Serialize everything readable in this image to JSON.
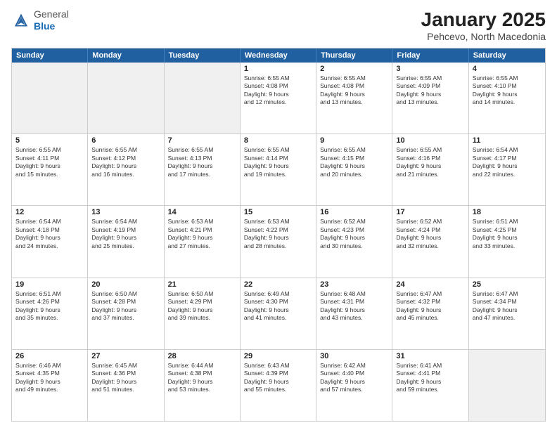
{
  "logo": {
    "general": "General",
    "blue": "Blue"
  },
  "title": "January 2025",
  "subtitle": "Pehcevo, North Macedonia",
  "days": [
    "Sunday",
    "Monday",
    "Tuesday",
    "Wednesday",
    "Thursday",
    "Friday",
    "Saturday"
  ],
  "weeks": [
    [
      {
        "day": "",
        "text": ""
      },
      {
        "day": "",
        "text": ""
      },
      {
        "day": "",
        "text": ""
      },
      {
        "day": "1",
        "text": "Sunrise: 6:55 AM\nSunset: 4:08 PM\nDaylight: 9 hours\nand 12 minutes."
      },
      {
        "day": "2",
        "text": "Sunrise: 6:55 AM\nSunset: 4:08 PM\nDaylight: 9 hours\nand 13 minutes."
      },
      {
        "day": "3",
        "text": "Sunrise: 6:55 AM\nSunset: 4:09 PM\nDaylight: 9 hours\nand 13 minutes."
      },
      {
        "day": "4",
        "text": "Sunrise: 6:55 AM\nSunset: 4:10 PM\nDaylight: 9 hours\nand 14 minutes."
      }
    ],
    [
      {
        "day": "5",
        "text": "Sunrise: 6:55 AM\nSunset: 4:11 PM\nDaylight: 9 hours\nand 15 minutes."
      },
      {
        "day": "6",
        "text": "Sunrise: 6:55 AM\nSunset: 4:12 PM\nDaylight: 9 hours\nand 16 minutes."
      },
      {
        "day": "7",
        "text": "Sunrise: 6:55 AM\nSunset: 4:13 PM\nDaylight: 9 hours\nand 17 minutes."
      },
      {
        "day": "8",
        "text": "Sunrise: 6:55 AM\nSunset: 4:14 PM\nDaylight: 9 hours\nand 19 minutes."
      },
      {
        "day": "9",
        "text": "Sunrise: 6:55 AM\nSunset: 4:15 PM\nDaylight: 9 hours\nand 20 minutes."
      },
      {
        "day": "10",
        "text": "Sunrise: 6:55 AM\nSunset: 4:16 PM\nDaylight: 9 hours\nand 21 minutes."
      },
      {
        "day": "11",
        "text": "Sunrise: 6:54 AM\nSunset: 4:17 PM\nDaylight: 9 hours\nand 22 minutes."
      }
    ],
    [
      {
        "day": "12",
        "text": "Sunrise: 6:54 AM\nSunset: 4:18 PM\nDaylight: 9 hours\nand 24 minutes."
      },
      {
        "day": "13",
        "text": "Sunrise: 6:54 AM\nSunset: 4:19 PM\nDaylight: 9 hours\nand 25 minutes."
      },
      {
        "day": "14",
        "text": "Sunrise: 6:53 AM\nSunset: 4:21 PM\nDaylight: 9 hours\nand 27 minutes."
      },
      {
        "day": "15",
        "text": "Sunrise: 6:53 AM\nSunset: 4:22 PM\nDaylight: 9 hours\nand 28 minutes."
      },
      {
        "day": "16",
        "text": "Sunrise: 6:52 AM\nSunset: 4:23 PM\nDaylight: 9 hours\nand 30 minutes."
      },
      {
        "day": "17",
        "text": "Sunrise: 6:52 AM\nSunset: 4:24 PM\nDaylight: 9 hours\nand 32 minutes."
      },
      {
        "day": "18",
        "text": "Sunrise: 6:51 AM\nSunset: 4:25 PM\nDaylight: 9 hours\nand 33 minutes."
      }
    ],
    [
      {
        "day": "19",
        "text": "Sunrise: 6:51 AM\nSunset: 4:26 PM\nDaylight: 9 hours\nand 35 minutes."
      },
      {
        "day": "20",
        "text": "Sunrise: 6:50 AM\nSunset: 4:28 PM\nDaylight: 9 hours\nand 37 minutes."
      },
      {
        "day": "21",
        "text": "Sunrise: 6:50 AM\nSunset: 4:29 PM\nDaylight: 9 hours\nand 39 minutes."
      },
      {
        "day": "22",
        "text": "Sunrise: 6:49 AM\nSunset: 4:30 PM\nDaylight: 9 hours\nand 41 minutes."
      },
      {
        "day": "23",
        "text": "Sunrise: 6:48 AM\nSunset: 4:31 PM\nDaylight: 9 hours\nand 43 minutes."
      },
      {
        "day": "24",
        "text": "Sunrise: 6:47 AM\nSunset: 4:32 PM\nDaylight: 9 hours\nand 45 minutes."
      },
      {
        "day": "25",
        "text": "Sunrise: 6:47 AM\nSunset: 4:34 PM\nDaylight: 9 hours\nand 47 minutes."
      }
    ],
    [
      {
        "day": "26",
        "text": "Sunrise: 6:46 AM\nSunset: 4:35 PM\nDaylight: 9 hours\nand 49 minutes."
      },
      {
        "day": "27",
        "text": "Sunrise: 6:45 AM\nSunset: 4:36 PM\nDaylight: 9 hours\nand 51 minutes."
      },
      {
        "day": "28",
        "text": "Sunrise: 6:44 AM\nSunset: 4:38 PM\nDaylight: 9 hours\nand 53 minutes."
      },
      {
        "day": "29",
        "text": "Sunrise: 6:43 AM\nSunset: 4:39 PM\nDaylight: 9 hours\nand 55 minutes."
      },
      {
        "day": "30",
        "text": "Sunrise: 6:42 AM\nSunset: 4:40 PM\nDaylight: 9 hours\nand 57 minutes."
      },
      {
        "day": "31",
        "text": "Sunrise: 6:41 AM\nSunset: 4:41 PM\nDaylight: 9 hours\nand 59 minutes."
      },
      {
        "day": "",
        "text": ""
      }
    ]
  ]
}
